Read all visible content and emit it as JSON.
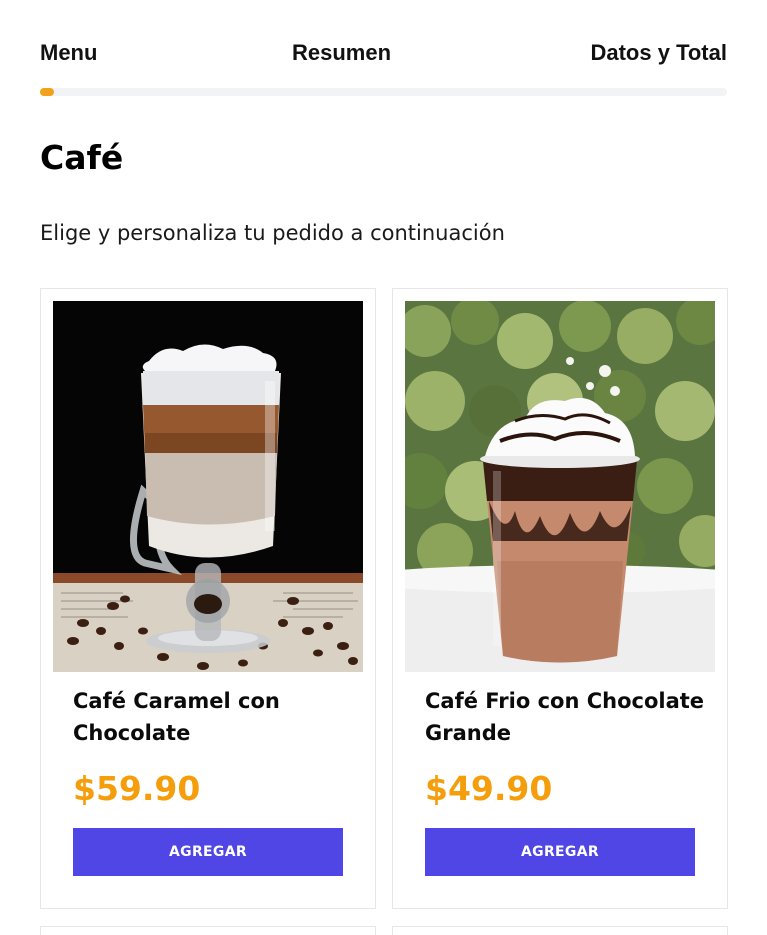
{
  "steps": [
    {
      "label": "Menu"
    },
    {
      "label": "Resumen"
    },
    {
      "label": "Datos y Total"
    }
  ],
  "progress": {
    "value_fraction": 0.0,
    "color": "#f2a21a"
  },
  "category": {
    "title": "Café",
    "subtitle": "Elige y personaliza tu pedido a continuación"
  },
  "products": [
    {
      "name": "Café Caramel con Chocolate",
      "price": "$59.90",
      "button_label": "AGREGAR",
      "image": "layered-latte-glass-photo"
    },
    {
      "name": "Café Frio con Chocolate Grande",
      "price": "$49.90",
      "button_label": "AGREGAR",
      "image": "iced-chocolate-frappe-photo"
    }
  ],
  "colors": {
    "accent": "#f2a21a",
    "price": "#f59e0b",
    "button": "#4f46e5"
  }
}
